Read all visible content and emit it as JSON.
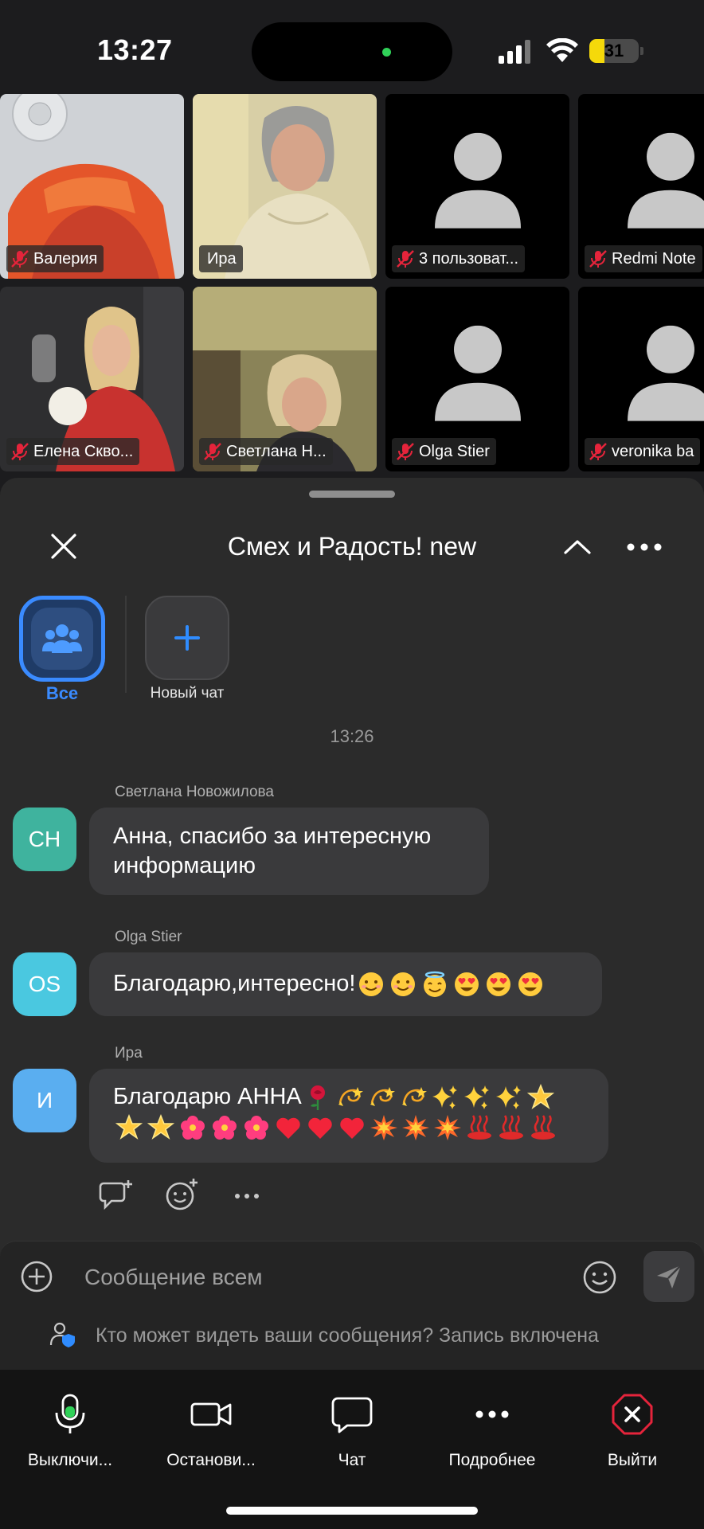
{
  "status_bar": {
    "time": "13:27",
    "battery_level": "31",
    "battery_fraction": 0.31,
    "colors": {
      "battery": "#f5d90a",
      "camera_dot": "#30d158"
    }
  },
  "participants": [
    {
      "name": "Валерия",
      "video": "on",
      "mic": "muted"
    },
    {
      "name": "Ира",
      "video": "on",
      "mic": "none"
    },
    {
      "name": "3 пользоват...",
      "video": "off",
      "mic": "muted"
    },
    {
      "name": "Redmi Note",
      "video": "off",
      "mic": "muted"
    },
    {
      "name": "Елена Скво...",
      "video": "on",
      "mic": "muted"
    },
    {
      "name": "Светлана Н...",
      "video": "on",
      "mic": "muted"
    },
    {
      "name": "Olga Stier",
      "video": "off",
      "mic": "muted"
    },
    {
      "name": "veronika ba",
      "video": "off",
      "mic": "muted"
    }
  ],
  "chat": {
    "title": "Смех и Радость! new",
    "chips": {
      "all_label": "Все",
      "new_chat_label": "Новый чат"
    },
    "timestamp": "13:26",
    "messages": [
      {
        "sender": "Светлана Новожилова",
        "initials": "СН",
        "avatar_color": "#3fb39e",
        "text": "Анна, спасибо за интересную информацию",
        "emojis": []
      },
      {
        "sender": "Olga Stier",
        "initials": "OS",
        "avatar_color": "#4ac8e0",
        "text": "Благодарю,интересно!",
        "emojis": [
          "smile",
          "smile",
          "halo",
          "heart-eyes",
          "heart-eyes",
          "heart-eyes"
        ]
      },
      {
        "sender": "Ира",
        "initials": "И",
        "avatar_color": "#5aaef0",
        "text": "Благодарю АННА",
        "emojis": [
          "rose",
          "dizzy",
          "dizzy",
          "dizzy",
          "sparkles",
          "sparkles",
          "sparkles",
          "glowing-star",
          "glowing-star",
          "glowing-star",
          "hibiscus",
          "hibiscus",
          "hibiscus",
          "heart",
          "heart",
          "heart",
          "collision",
          "collision",
          "collision",
          "hot-springs",
          "hot-springs",
          "hot-springs"
        ]
      }
    ],
    "composer": {
      "placeholder": "Сообщение всем",
      "privacy_text": "Кто может видеть ваши сообщения? Запись включена"
    }
  },
  "toolbar": {
    "mute_label": "Выключи...",
    "video_label": "Останови...",
    "chat_label": "Чат",
    "more_label": "Подробнее",
    "leave_label": "Выйти",
    "colors": {
      "leave": "#e5243b"
    }
  }
}
